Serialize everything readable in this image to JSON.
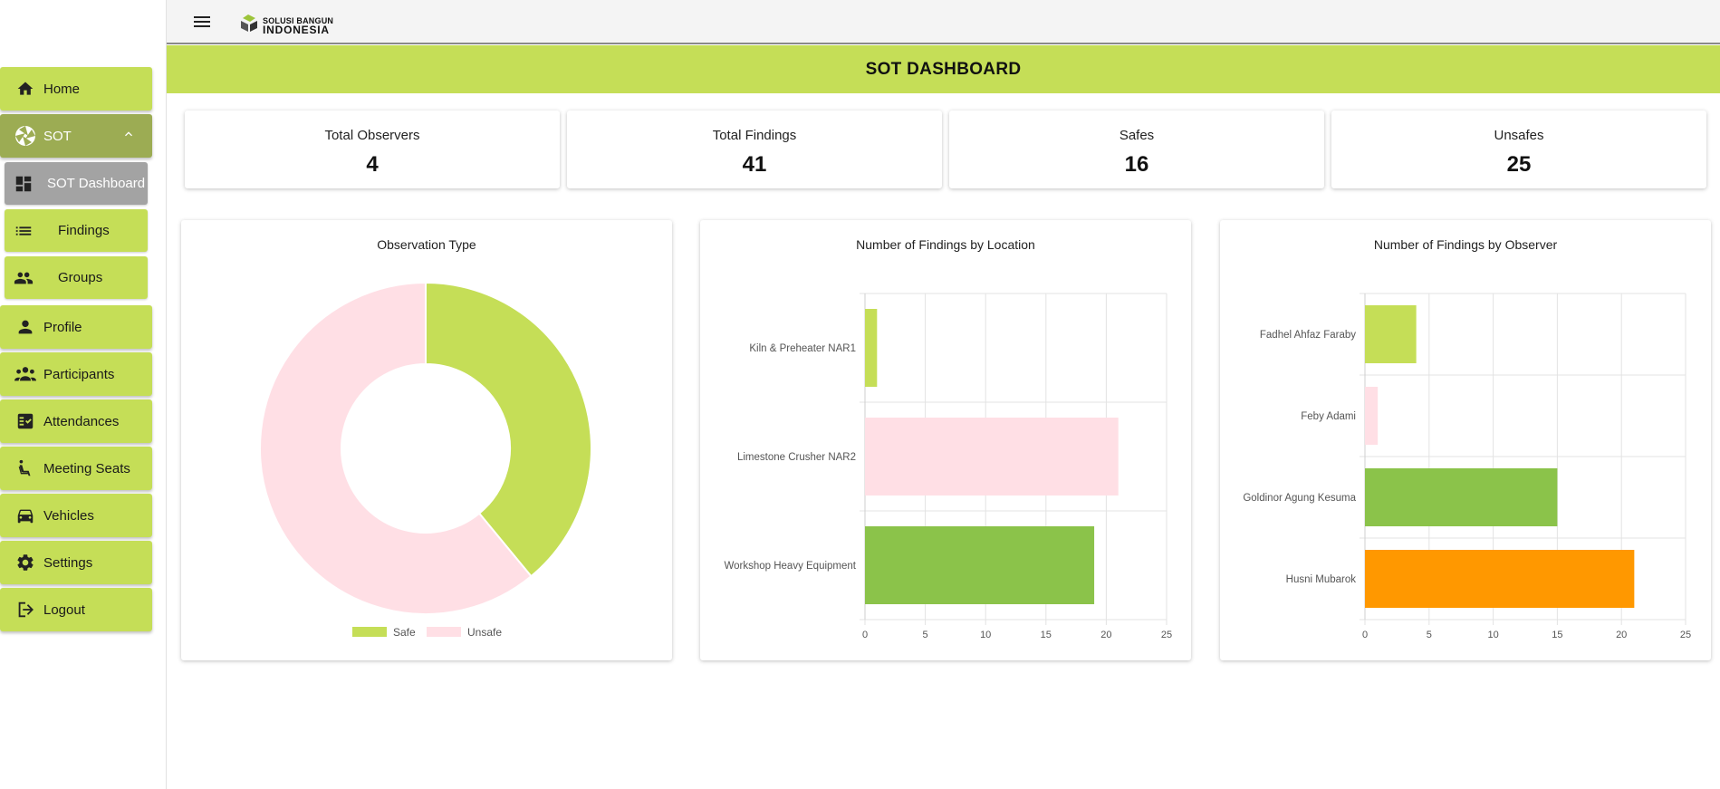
{
  "app": {
    "logo_line1": "SOLUSI BANGUN",
    "logo_line2": "INDONESIA",
    "page_title": "SOT DASHBOARD"
  },
  "sidebar": {
    "items": [
      {
        "label": "Home",
        "icon": "home-icon"
      },
      {
        "label": "SOT",
        "icon": "sot-icon"
      },
      {
        "label": "Profile",
        "icon": "person-icon"
      },
      {
        "label": "Participants",
        "icon": "people-icon"
      },
      {
        "label": "Attendances",
        "icon": "checklist-icon"
      },
      {
        "label": "Meeting Seats",
        "icon": "seat-icon"
      },
      {
        "label": "Vehicles",
        "icon": "car-icon"
      },
      {
        "label": "Settings",
        "icon": "gear-icon"
      },
      {
        "label": "Logout",
        "icon": "logout-icon"
      }
    ],
    "sot_sub": [
      {
        "label": "SOT Dashboard",
        "icon": "dashboard-icon",
        "active": true
      },
      {
        "label": "Findings",
        "icon": "list-icon"
      },
      {
        "label": "Groups",
        "icon": "group-icon"
      }
    ]
  },
  "stats": [
    {
      "label": "Total Observers",
      "value": "4"
    },
    {
      "label": "Total Findings",
      "value": "41"
    },
    {
      "label": "Safes",
      "value": "16"
    },
    {
      "label": "Unsafes",
      "value": "25"
    }
  ],
  "colors": {
    "accent": "#c5de57",
    "safe": "#c5de57",
    "unsafe": "#ffdfe5",
    "green": "#8bc34a",
    "orange": "#ff9800"
  },
  "chart_data": [
    {
      "type": "pie",
      "title": "Observation Type",
      "categories": [
        "Safe",
        "Unsafe"
      ],
      "values": [
        16,
        25
      ],
      "colors": [
        "#c5de57",
        "#ffdfe5"
      ],
      "legend": "bottom"
    },
    {
      "type": "bar",
      "orientation": "horizontal",
      "title": "Number of Findings by Location",
      "categories": [
        "Kiln & Preheater NAR1",
        "Limestone Crusher NAR2",
        "Workshop Heavy Equipment"
      ],
      "values": [
        1,
        21,
        19
      ],
      "colors": [
        "#c5de57",
        "#ffdfe5",
        "#8bc34a"
      ],
      "xlim": [
        0,
        25
      ],
      "xticks": [
        "0",
        "5",
        "10",
        "15",
        "20",
        "25"
      ],
      "grid": true
    },
    {
      "type": "bar",
      "orientation": "horizontal",
      "title": "Number of Findings by Observer",
      "categories": [
        "Fadhel Ahfaz Faraby",
        "Feby Adami",
        "Goldinor Agung Kesuma",
        "Husni Mubarok"
      ],
      "values": [
        4,
        1,
        15,
        21
      ],
      "colors": [
        "#c5de57",
        "#ffdfe5",
        "#8bc34a",
        "#ff9800"
      ],
      "xlim": [
        0,
        25
      ],
      "xticks": [
        "0",
        "5",
        "10",
        "15",
        "20",
        "25"
      ],
      "grid": true
    }
  ]
}
